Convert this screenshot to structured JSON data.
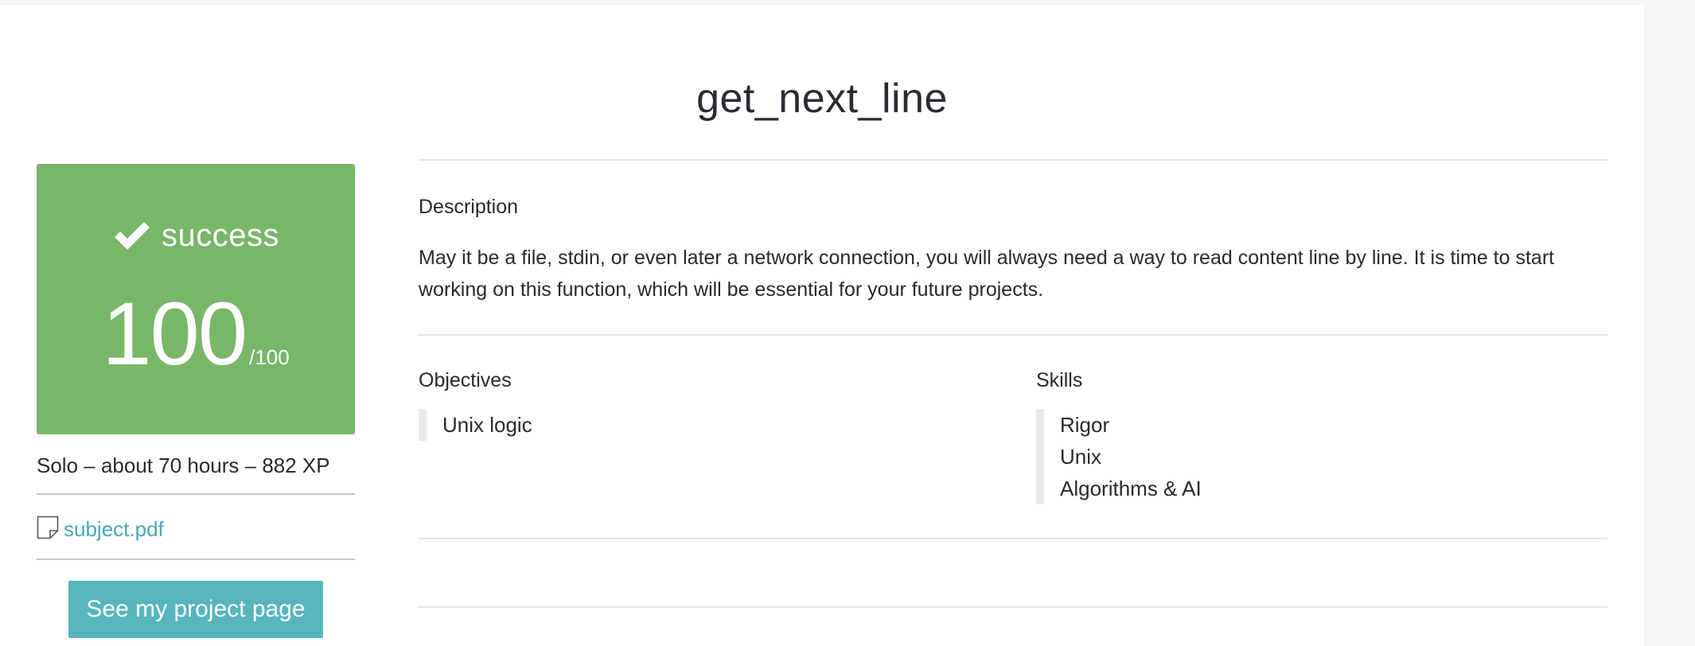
{
  "project": {
    "title": "get_next_line"
  },
  "status": {
    "label": "success",
    "score": "100",
    "score_max": "/100",
    "icon": "check-icon",
    "color": "#78b668"
  },
  "meta": {
    "text": "Solo – about 70 hours – 882 XP"
  },
  "subject": {
    "icon": "document-icon",
    "label": "subject.pdf",
    "color": "#4aa7b4"
  },
  "actions": {
    "project_page_label": "See my project page",
    "button_color": "#56b6bc"
  },
  "description": {
    "heading": "Description",
    "text": "May it be a file, stdin, or even later a network connection, you will always need a way to read content line by line. It is time to start working on this function, which will be essential for your future projects."
  },
  "objectives": {
    "heading": "Objectives",
    "items": [
      "Unix logic"
    ]
  },
  "skills": {
    "heading": "Skills",
    "items": [
      "Rigor",
      "Unix",
      "Algorithms & AI"
    ]
  }
}
